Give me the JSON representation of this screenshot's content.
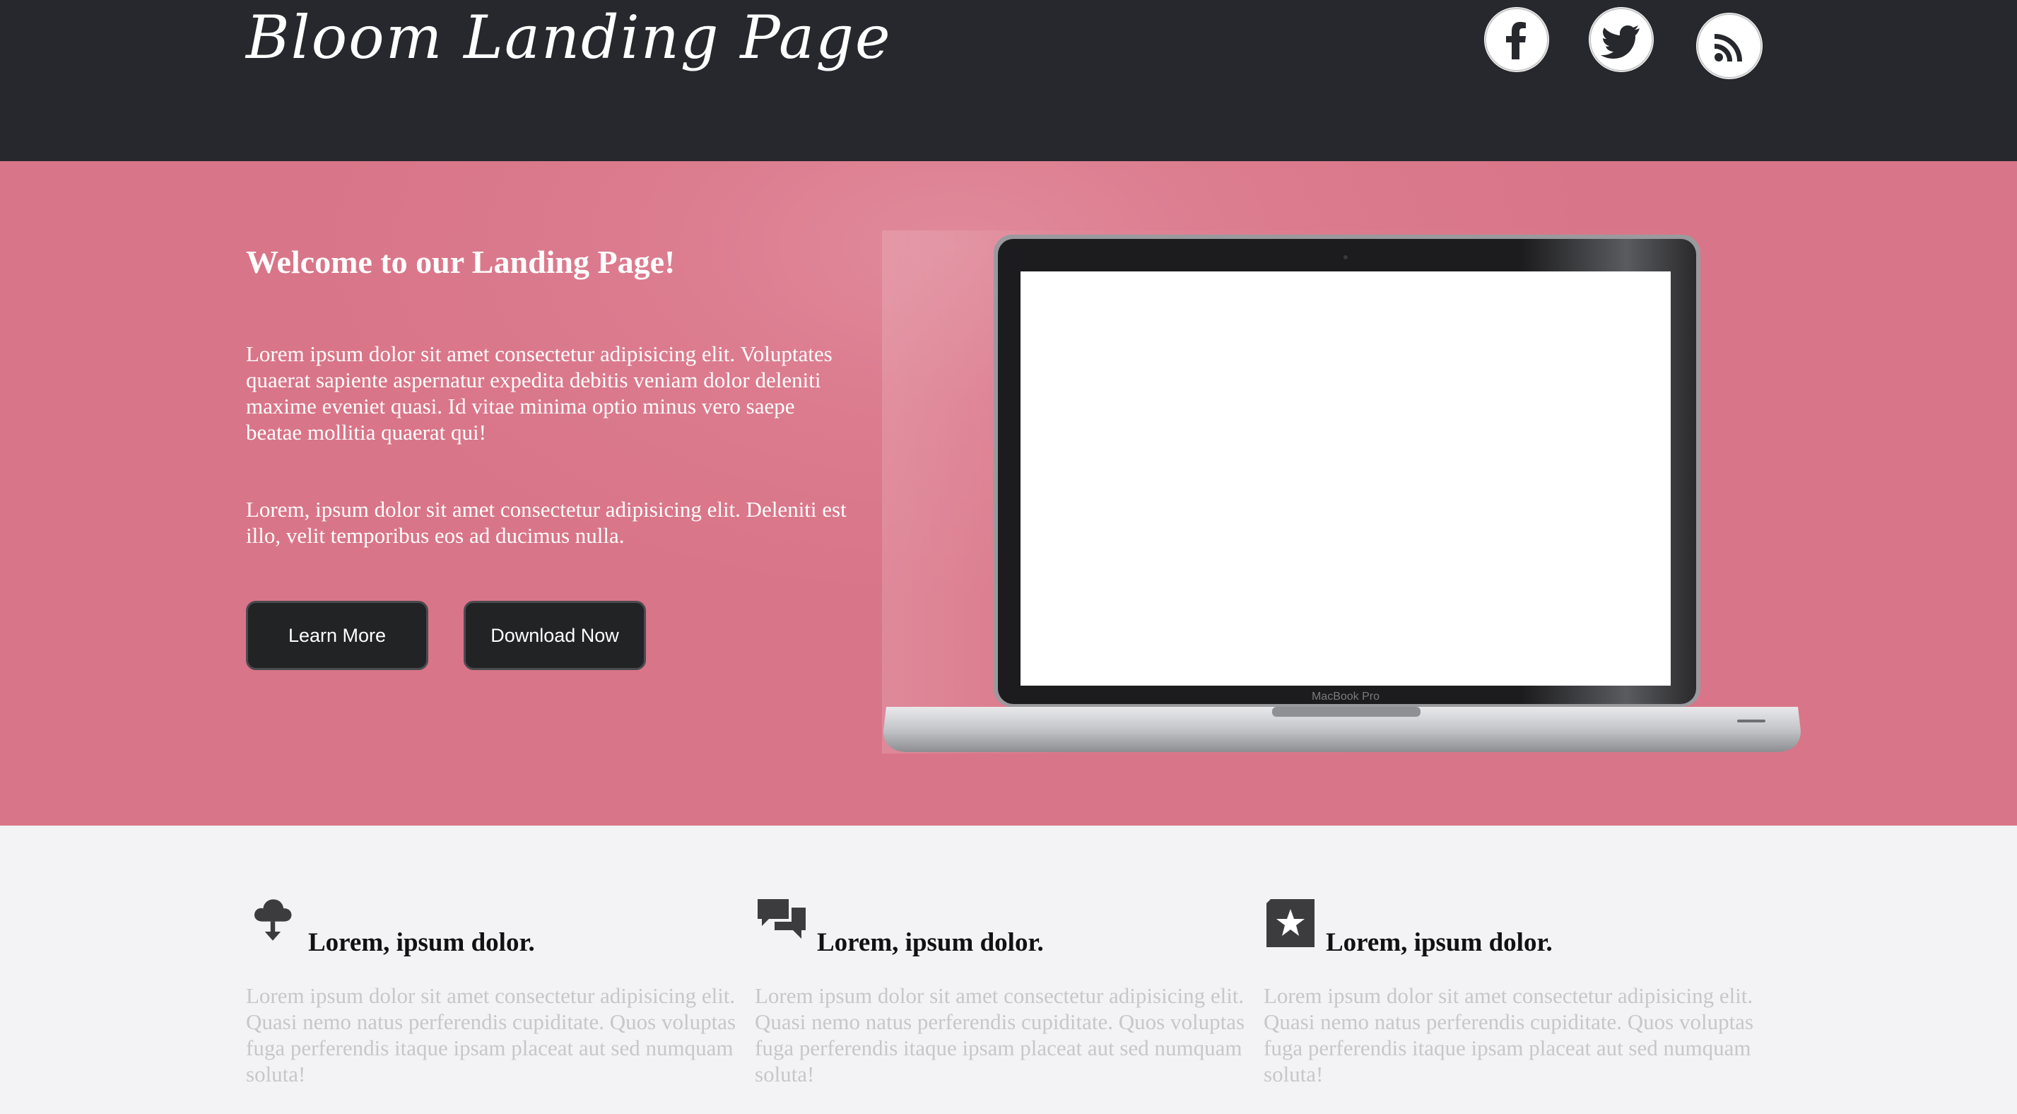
{
  "header": {
    "brand": "Bloom Landing Page",
    "social": [
      {
        "name": "facebook-icon"
      },
      {
        "name": "twitter-icon"
      },
      {
        "name": "rss-icon"
      }
    ]
  },
  "hero": {
    "title": "Welcome to our Landing Page!",
    "paragraph1": "Lorem ipsum dolor sit amet consectetur adipisicing elit. Voluptates quaerat sapiente aspernatur expedita debitis veniam dolor deleniti maxime eveniet quasi. Id vitae minima optio minus vero saepe beatae mollitia quaerat qui!",
    "paragraph2": "Lorem, ipsum dolor sit amet consectetur adipisicing elit. Deleniti est illo, velit temporibus eos ad ducimus nulla.",
    "learn_more_label": "Learn More",
    "download_label": "Download Now",
    "laptop_brand": "MacBook Pro"
  },
  "features": [
    {
      "icon": "cloud-download-icon",
      "title": "Lorem, ipsum dolor.",
      "text": "Lorem ipsum dolor sit amet consectetur adipisicing elit. Quasi nemo natus perferendis cupiditate. Quos voluptas fuga perferendis itaque ipsam placeat aut sed numquam soluta!"
    },
    {
      "icon": "chat-bubbles-icon",
      "title": "Lorem, ipsum dolor.",
      "text": "Lorem ipsum dolor sit amet consectetur adipisicing elit. Quasi nemo natus perferendis cupiditate. Quos voluptas fuga perferendis itaque ipsam placeat aut sed numquam soluta!"
    },
    {
      "icon": "star-icon",
      "title": "Lorem, ipsum dolor.",
      "text": "Lorem ipsum dolor sit amet consectetur adipisicing elit. Quasi nemo natus perferendis cupiditate. Quos voluptas fuga perferendis itaque ipsam placeat aut sed numquam soluta!"
    }
  ],
  "colors": {
    "header_bg": "#27282d",
    "hero_bg": "#d97588",
    "button_bg": "#222325",
    "features_bg": "#f3f3f5",
    "feature_text": "#c7c7cb"
  }
}
